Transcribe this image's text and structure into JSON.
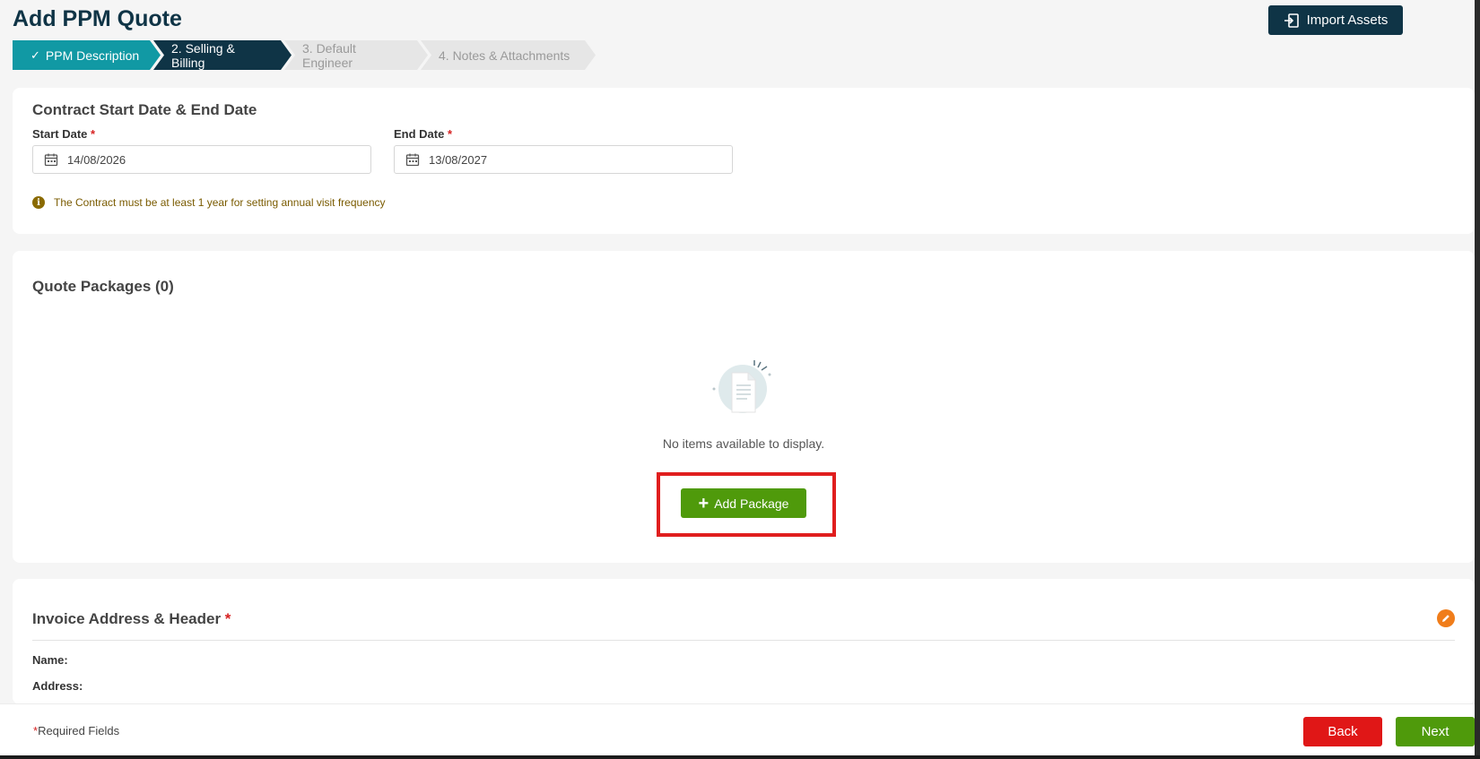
{
  "page": {
    "title": "Add PPM Quote"
  },
  "header": {
    "import_label": "Import Assets"
  },
  "stepper": {
    "steps": [
      {
        "label": "PPM Description",
        "state": "done"
      },
      {
        "label": "2. Selling & Billing",
        "state": "active"
      },
      {
        "label": "3. Default Engineer",
        "state": "pending"
      },
      {
        "label": "4. Notes & Attachments",
        "state": "pending"
      }
    ]
  },
  "dates": {
    "title": "Contract Start Date & End Date",
    "start_label": "Start Date",
    "start_value": "14/08/2026",
    "end_label": "End Date",
    "end_value": "13/08/2027",
    "required_mark": "*",
    "info_text": "The Contract must be at least 1 year for setting annual visit frequency"
  },
  "packages": {
    "title": "Quote Packages (0)",
    "empty_text": "No items available to display.",
    "add_label": "Add Package"
  },
  "invoice": {
    "title": "Invoice Address & Header",
    "required_mark": "*",
    "name_label": "Name:",
    "address_label": "Address:"
  },
  "footer": {
    "required_mark": "*",
    "required_note": "Required Fields",
    "back_label": "Back",
    "next_label": "Next"
  },
  "colors": {
    "primary_dark": "#0f3446",
    "teal": "#1199a4",
    "green": "#4f9a0b",
    "red": "#e01717",
    "orange": "#f07d1a",
    "highlight": "#e01e1e"
  },
  "icons": {
    "import": "import-icon",
    "check": "check-icon",
    "calendar": "calendar-icon",
    "info": "info-icon",
    "plus": "plus-icon",
    "edit": "pencil-icon",
    "empty": "empty-document-icon"
  }
}
